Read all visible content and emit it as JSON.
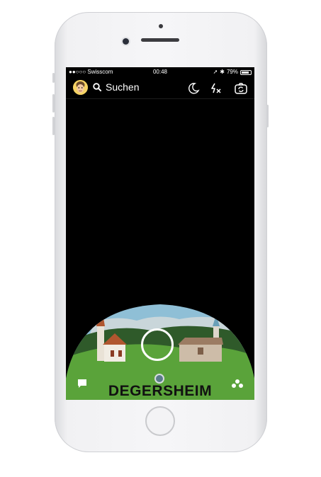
{
  "status_bar": {
    "carrier": "●●○○○ Swisscom",
    "time": "00:48",
    "battery": "79%",
    "battery_level": 0.79
  },
  "top_bar": {
    "search_label": "Suchen",
    "icons": [
      "bitmoji-avatar",
      "search-icon",
      "night-mode-icon",
      "flash-off-icon",
      "flip-camera-icon"
    ]
  },
  "geofilter": {
    "town_name": "DEGERSHEIM"
  },
  "bottom_bar": {
    "icons": [
      "chat-icon",
      "memories-icon",
      "stories-icon"
    ]
  },
  "colors": {
    "sky": "#8fbfd6",
    "grass": "#5aa33a",
    "hills": "#2f5a2a",
    "screen_bg": "#000000"
  }
}
